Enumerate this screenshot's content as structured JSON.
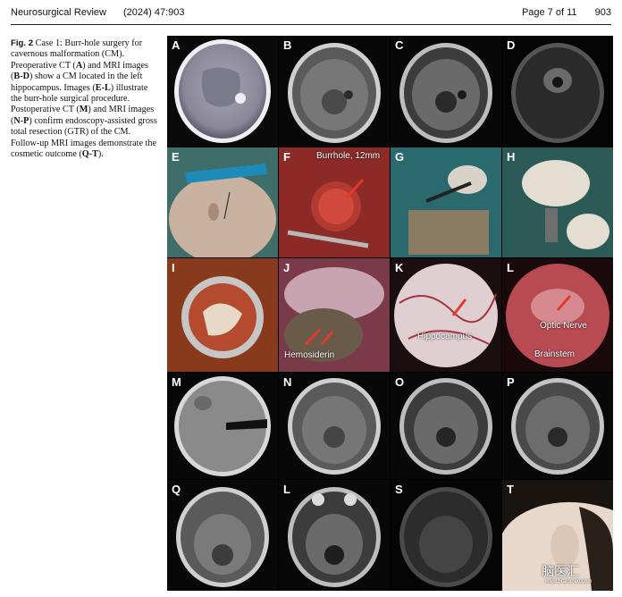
{
  "header": {
    "journal": "Neurosurgical Review",
    "year_volume": "(2024) 47:903",
    "page_label": "Page 7 of 11",
    "article_number": "903"
  },
  "caption": {
    "fig_label": "Fig. 2",
    "p1": " Case 1: Burr-hole surgery for cavernous malformation (CM). Preoperative CT (",
    "A": "A",
    "p2": ") and MRI images (",
    "BD": "B-D",
    "p3": ") show a CM located in the left hippocampus. Images (",
    "EL": "E-L",
    "p4": ") illustrate the burr-hole surgical procedure. Postoperative CT (",
    "M": "M",
    "p5": ") and MRI images (",
    "NP": "N-P",
    "p6": ") confirm endoscopy-assisted gross total resection (GTR) of the CM. Follow-up MRI images demonstrate the cosmetic outcome (",
    "QT": "Q-T",
    "p7": ")."
  },
  "panels": {
    "A": "A",
    "B": "B",
    "C": "C",
    "D": "D",
    "E": "E",
    "F": "F",
    "G": "G",
    "H": "H",
    "I": "I",
    "J": "J",
    "K": "K",
    "L": "L",
    "M": "M",
    "N": "N",
    "O": "O",
    "P": "P",
    "Q": "Q",
    "L2": "L",
    "S": "S",
    "T": "T"
  },
  "annotations": {
    "burrhole": "Burrhole, 12mm",
    "hemosiderin": "Hemosiderin",
    "hippocampus": "Hippocampus",
    "optic_nerve": "Optic Nerve",
    "brainstem": "Brainstem",
    "watermark": "脑医汇",
    "watermark_url": "www.brainmed.com"
  },
  "colors": {
    "arrow": "#e23a2a",
    "label": "#ffffff"
  }
}
